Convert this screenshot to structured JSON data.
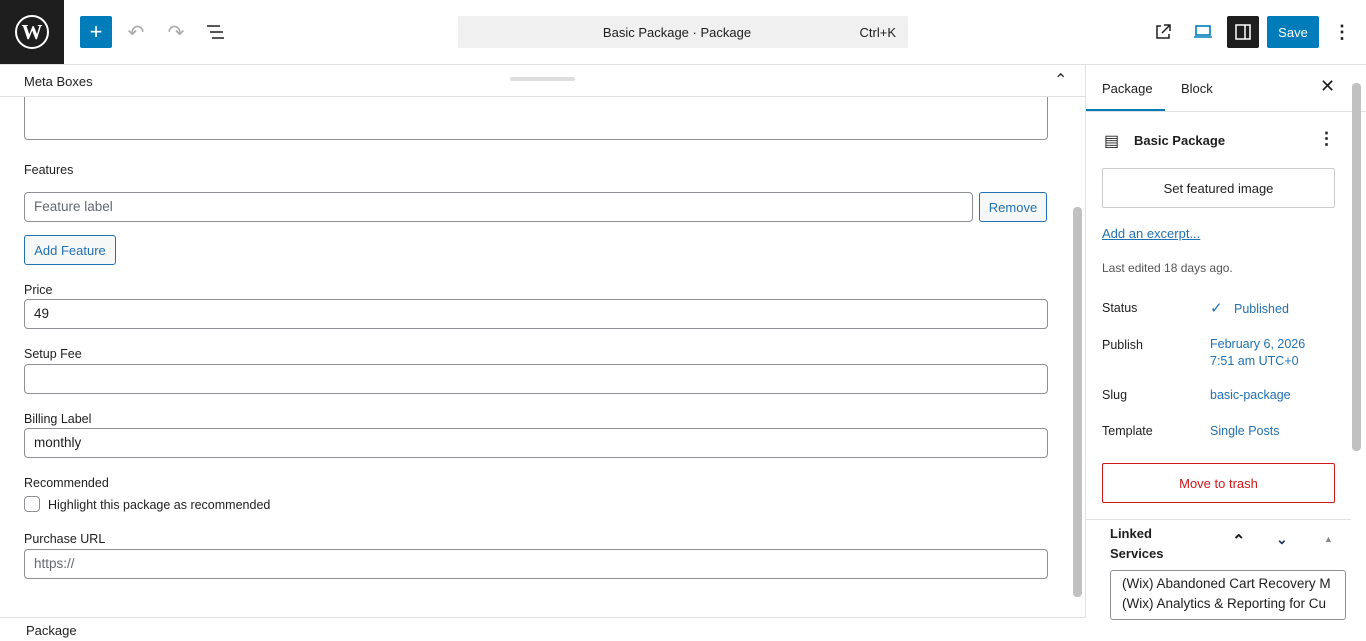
{
  "header": {
    "title": "Basic Package · Package",
    "shortcut": "Ctrl+K",
    "save": "Save"
  },
  "metaboxes": {
    "title": "Meta Boxes"
  },
  "form": {
    "features_label": "Features",
    "feature_placeholder": "Feature label",
    "remove": "Remove",
    "add_feature": "Add Feature",
    "price_label": "Price",
    "price_value": "49",
    "setup_fee_label": "Setup Fee",
    "setup_fee_value": "",
    "billing_label": "Billing Label",
    "billing_value": "monthly",
    "recommended_label": "Recommended",
    "recommended_checkbox": "Highlight this package as recommended",
    "recommended_checked": false,
    "purchase_url_label": "Purchase URL",
    "purchase_url_placeholder": "https://"
  },
  "footer": {
    "breadcrumb": "Package"
  },
  "sidebar": {
    "tabs": [
      "Package",
      "Block"
    ],
    "post_title": "Basic Package",
    "featured_image": "Set featured image",
    "excerpt": "Add an excerpt...",
    "last_edited": "Last edited 18 days ago.",
    "status_label": "Status",
    "status_value": "Published",
    "publish_label": "Publish",
    "publish_date": "February 6, 2026",
    "publish_time": "7:51 am UTC+0",
    "slug_label": "Slug",
    "slug_value": "basic-package",
    "template_label": "Template",
    "template_value": "Single Posts",
    "trash": "Move to trash",
    "linked_title": "Linked Services",
    "linked_items": [
      "(Wix) Abandoned Cart Recovery M",
      "(Wix) Analytics & Reporting for Cu"
    ]
  }
}
